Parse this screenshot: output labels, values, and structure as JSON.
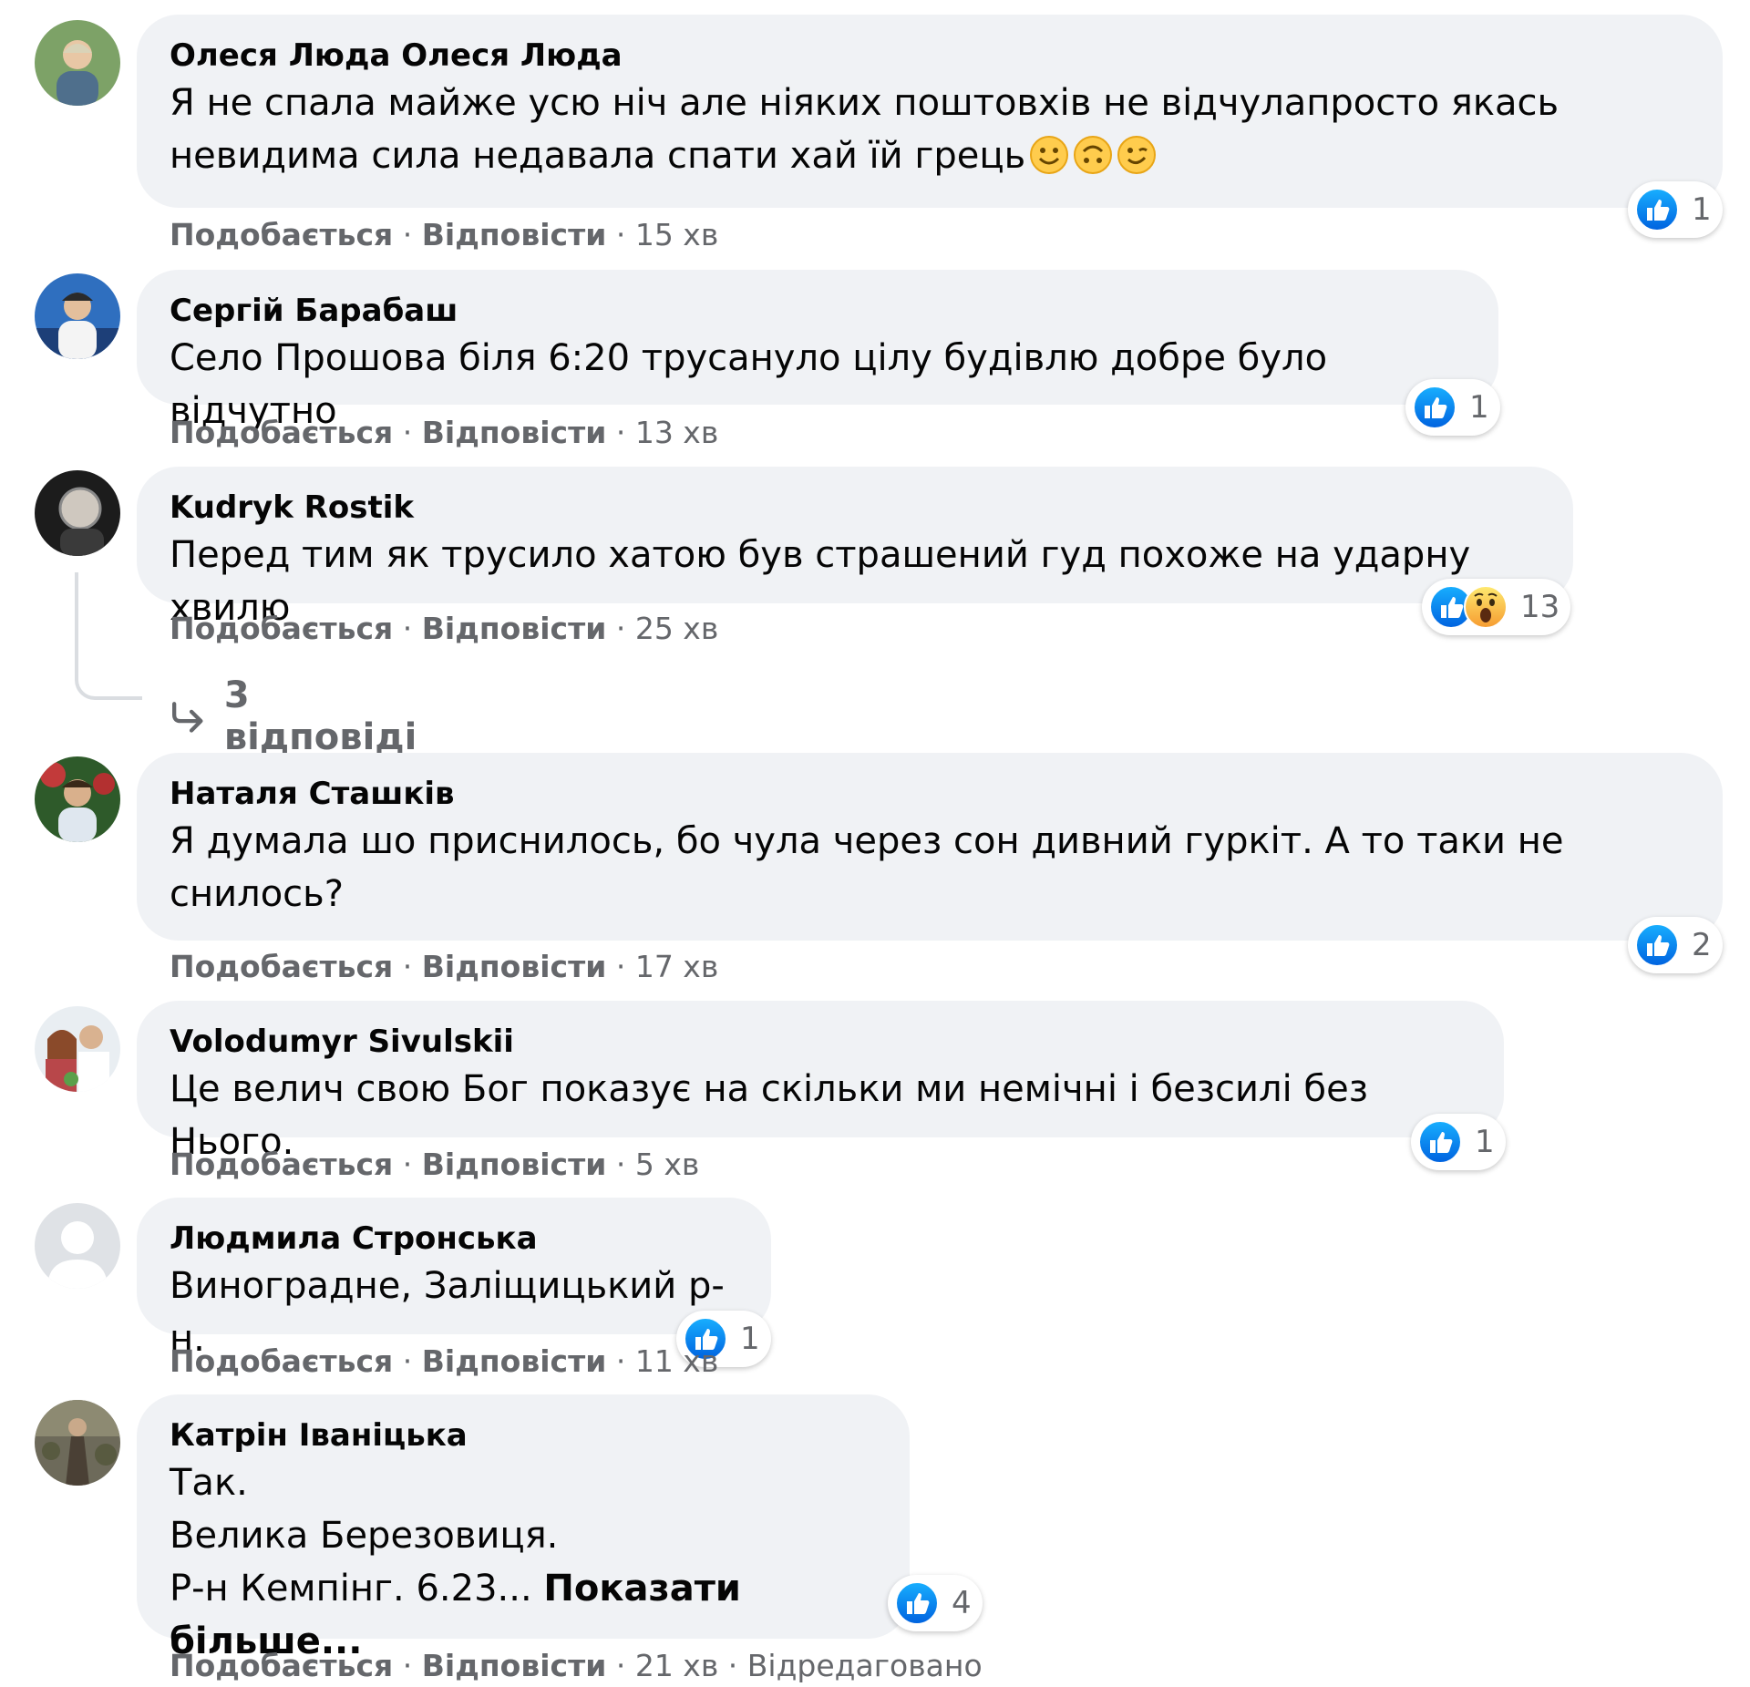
{
  "action_like": "Подобається",
  "action_reply": "Відповісти",
  "separator": "·",
  "comments": [
    {
      "author": "Олеся Люда Олеся Люда",
      "text": "Я не спала майже усю ніч але ніяких поштовхів не відчулапросто якась\nневидима сила недавала спати хай їй грець",
      "emojis": [
        "slightly-smiling-face",
        "upside-down-face",
        "winking-face"
      ],
      "reaction_count": "1",
      "time": "15 хв"
    },
    {
      "author": "Сергій Барабаш",
      "text": "Село Прошова біля 6:20 трусануло цілу будівлю добре було відчутно",
      "reaction_count": "1",
      "time": "13 хв"
    },
    {
      "author": "Kudryk Rostik",
      "text": "Перед тим як трусило хатою був страшений гуд похоже на ударну хвилю",
      "reaction_count": "13",
      "time": "25 хв",
      "replies_label": "3 відповіді"
    },
    {
      "author": "Наталя Сташків",
      "text": "Я думала шо приснилось, бо чула через сон дивний гуркіт. А то таки не\nснилось?",
      "reaction_count": "2",
      "time": "17 хв"
    },
    {
      "author": "Volodumyr Sivulskii",
      "text": "Це велич свою Бог показує на скільки ми немічні і безсилі без Нього.",
      "reaction_count": "1",
      "time": "5 хв"
    },
    {
      "author": "Людмила Стронська",
      "text": "Виноградне, Заліщицький р-н.",
      "reaction_count": "1",
      "time": "11 хв"
    },
    {
      "author": "Катрін Іваніцька",
      "text": "Так.\nВелика Березовиця.\nР-н Кемпінг. 6.23... ",
      "more": "Показати більше...",
      "reaction_count": "4",
      "time": "21 хв",
      "edited": "Відредаговано"
    }
  ],
  "icons": {
    "like": "like-reaction-icon",
    "wow": "wow-reaction-icon",
    "reply_arrow": "reply-arrow-icon"
  },
  "colors": {
    "bubble": "#f0f2f5",
    "meta": "#65676b",
    "like_blue": "#1877f2",
    "text": "#050505"
  }
}
